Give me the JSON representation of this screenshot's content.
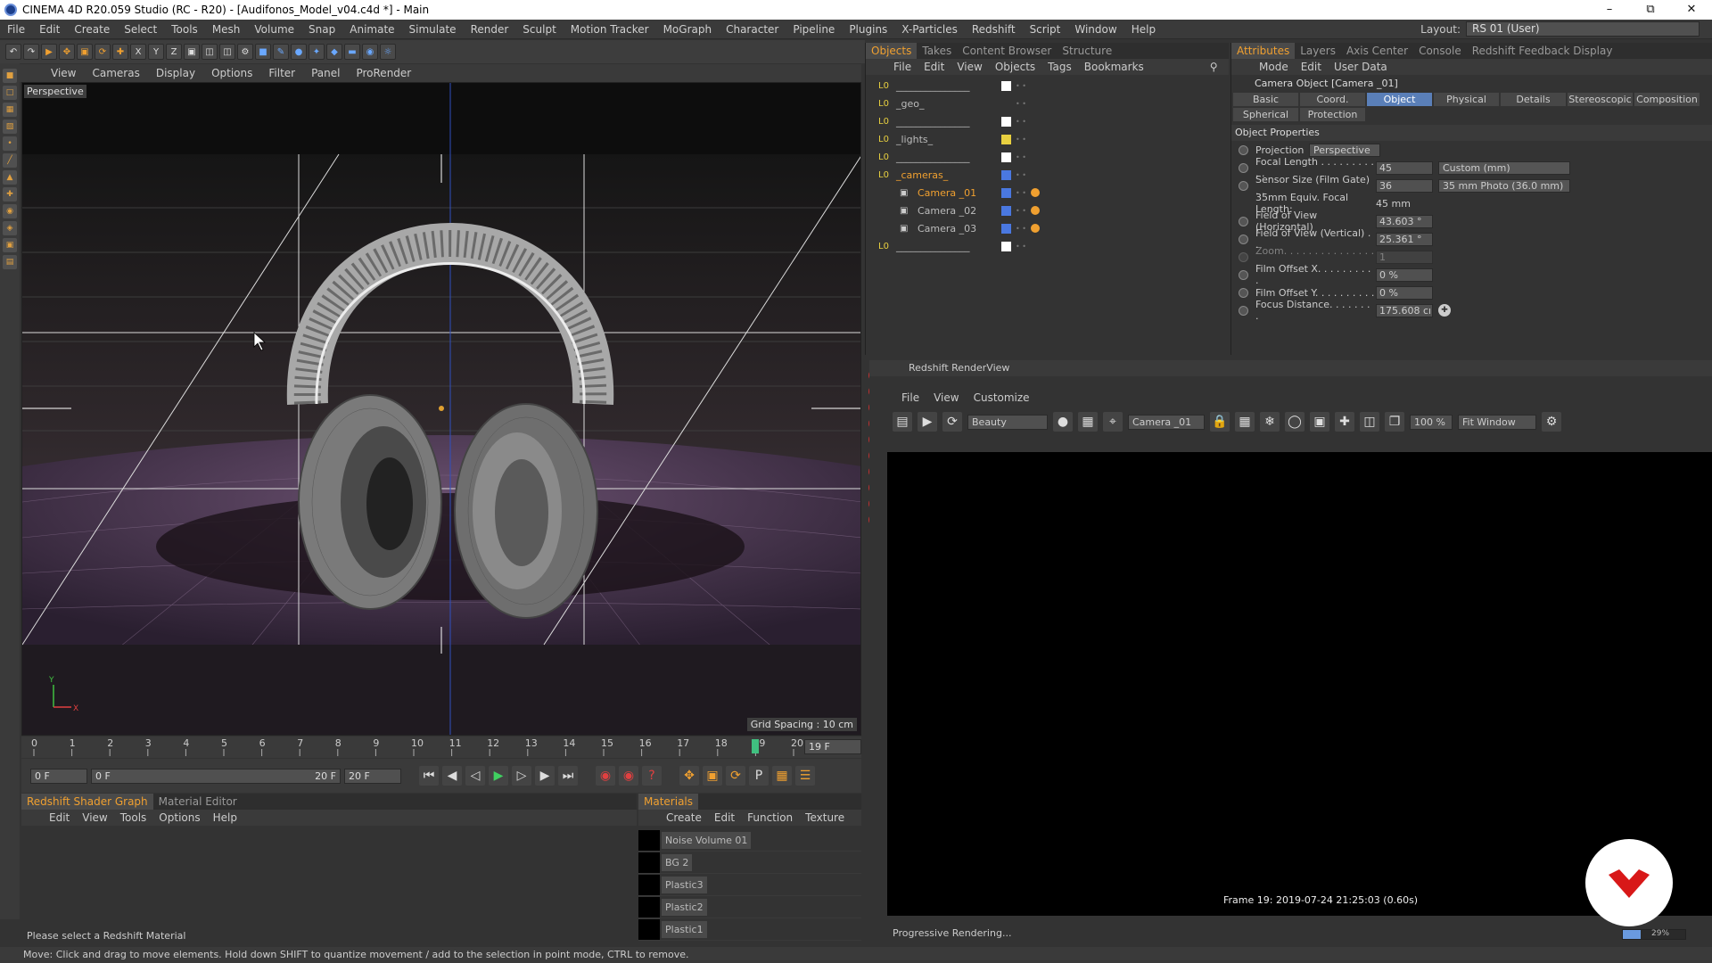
{
  "titlebar": {
    "title": "CINEMA 4D R20.059 Studio (RC - R20) - [Audifonos_Model_v04.c4d *] - Main"
  },
  "menubar": [
    "File",
    "Edit",
    "Create",
    "Select",
    "Tools",
    "Mesh",
    "Volume",
    "Snap",
    "Animate",
    "Simulate",
    "Render",
    "Sculpt",
    "Motion Tracker",
    "MoGraph",
    "Character",
    "Pipeline",
    "Plugins",
    "X-Particles",
    "Redshift",
    "Script",
    "Window",
    "Help"
  ],
  "layout": {
    "label": "Layout:",
    "value": "RS 01 (User)"
  },
  "viewport": {
    "menu": [
      "View",
      "Cameras",
      "Display",
      "Options",
      "Filter",
      "Panel",
      "ProRender"
    ],
    "label": "Perspective",
    "grid_spacing": "Grid Spacing : 10 cm"
  },
  "timeline": {
    "ticks": [
      "0",
      "1",
      "2",
      "3",
      "4",
      "5",
      "6",
      "7",
      "8",
      "9",
      "10",
      "11",
      "12",
      "13",
      "14",
      "15",
      "16",
      "17",
      "18",
      "19",
      "20"
    ],
    "current_frame": "19 F",
    "start": "0 F",
    "range_start": "0 F",
    "range_end": "20 F",
    "end": "20 F"
  },
  "shader": {
    "tabs": [
      "Redshift Shader Graph",
      "Material Editor"
    ],
    "menu": [
      "Edit",
      "View",
      "Tools",
      "Options",
      "Help"
    ],
    "hint": "Please select a Redshift Material"
  },
  "materials": {
    "tab": "Materials",
    "menu": [
      "Create",
      "Edit",
      "Function",
      "Texture"
    ],
    "items": [
      "Noise Volume 01",
      "BG 2",
      "Plastic3",
      "Plastic2",
      "Plastic1"
    ]
  },
  "objects": {
    "tabs": [
      "Objects",
      "Takes",
      "Content Browser",
      "Structure"
    ],
    "menu": [
      "File",
      "Edit",
      "View",
      "Objects",
      "Tags",
      "Bookmarks"
    ],
    "rows": [
      {
        "name": "_______________",
        "color": "#ffffff"
      },
      {
        "name": "_geo_",
        "color": ""
      },
      {
        "name": "_______________",
        "color": "#ffffff"
      },
      {
        "name": "_lights_",
        "color": "#e8d040"
      },
      {
        "name": "_______________",
        "color": "#ffffff"
      },
      {
        "name": "_cameras_",
        "color": "#4a78e0"
      },
      {
        "name": "Camera _01",
        "color": "#4a78e0"
      },
      {
        "name": "Camera _02",
        "color": "#4a78e0"
      },
      {
        "name": "Camera _03",
        "color": "#4a78e0"
      },
      {
        "name": "_______________",
        "color": "#ffffff"
      }
    ]
  },
  "attributes": {
    "tabs_top": [
      "Attributes",
      "Layers",
      "Axis Center",
      "Console",
      "Redshift Feedback Display"
    ],
    "menu": [
      "Mode",
      "Edit",
      "User Data"
    ],
    "object_title": "Camera Object [Camera _01]",
    "tabs": [
      "Basic",
      "Coord.",
      "Object",
      "Physical",
      "Details",
      "Stereoscopic",
      "Composition",
      "Spherical",
      "Protection"
    ],
    "section": "Object Properties",
    "projection_label": "Projection",
    "projection_value": "Perspective",
    "focal_length_label": "Focal Length . . . . . . . . . . .",
    "focal_length": "45",
    "focal_mode": "Custom (mm)",
    "sensor_label": "Sensor Size (Film Gate) . .",
    "sensor": "36",
    "sensor_mode": "35 mm Photo (36.0 mm)",
    "equiv_label": "35mm Equiv. Focal Length:",
    "equiv": "45 mm",
    "fovh_label": "Field of View (Horizontal)",
    "fovh": "43.603 °",
    "fovv_label": "Field of View (Vertical) . .",
    "fovv": "25.361 °",
    "zoom_label": "Zoom. . . . . . . . . . . . . . . .",
    "zoom": "1",
    "offx_label": "Film Offset X. . . . . . . . . .",
    "offx": "0 %",
    "offy_label": "Film Offset Y. . . . . . . . . .",
    "offy": "0 %",
    "focus_label": "Focus Distance. . . . . . . .",
    "focus": "175.608 cı"
  },
  "rsview": {
    "title": "Redshift RenderView",
    "menu": [
      "File",
      "View",
      "Customize"
    ],
    "aov": "Beauty",
    "camera": "Camera _01",
    "zoom": "100 %",
    "fit": "Fit Window",
    "frame_info": "Frame  19:  2019-07-24  21:25:03  (0.60s)",
    "status": "Progressive Rendering...",
    "progress": "29%",
    "progress_value": 0.29
  },
  "statusbar": {
    "text": "Move: Click and drag to move elements. Hold down SHIFT to quantize movement / add to the selection in point mode, CTRL to remove."
  },
  "colors": {
    "accent": "#f0a030",
    "selected": "#5a7fb8"
  }
}
